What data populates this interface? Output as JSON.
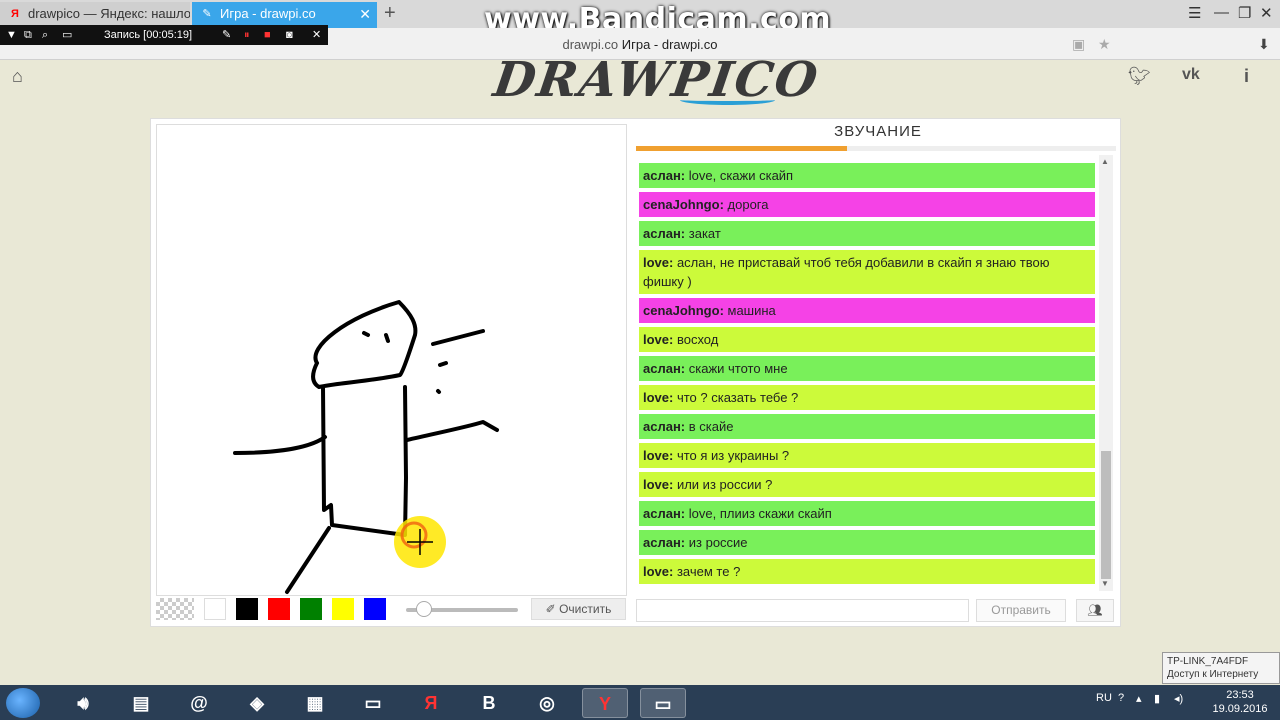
{
  "browser": {
    "tabs": [
      {
        "title": "drawpico — Яндекс: нашло",
        "active": false
      },
      {
        "title": "Игра - drawpi.co",
        "active": true
      }
    ],
    "address": {
      "domain": "drawpi.co",
      "page_title": "Игра - drawpi.co"
    }
  },
  "watermark": "www.Bandicam.com",
  "recorder": {
    "label": "Запись [00:05:19]"
  },
  "logo": "DRAWPICO",
  "game": {
    "word_title": "ЗВУЧАНИЕ",
    "timer_progress": 0.44,
    "tools": {
      "colors": [
        "#ffffff",
        "#000000",
        "#ff0000",
        "#008000",
        "#ffff00",
        "#0000ff"
      ],
      "brush_size": 0.1,
      "clear_label": "Очистить"
    },
    "chat": {
      "messages": [
        {
          "user": "аслан:",
          "text": " love,  скажи скайп",
          "color": "green"
        },
        {
          "user": "cenaJohngo:",
          "text": " дорога",
          "color": "pink"
        },
        {
          "user": "аслан:",
          "text": " закат",
          "color": "green"
        },
        {
          "user": "love:",
          "text": "  аслан,  не приставай чтоб тебя добавили в скайп я знаю твою фишку )",
          "color": "yellow"
        },
        {
          "user": "cenaJohngo:",
          "text": " машина",
          "color": "pink"
        },
        {
          "user": "love:",
          "text": " восход",
          "color": "yellow"
        },
        {
          "user": "аслан:",
          "text": " скажи чтото мне",
          "color": "green"
        },
        {
          "user": "love:",
          "text": " что ? сказать тебе ?",
          "color": "yellow"
        },
        {
          "user": "аслан:",
          "text": " в скайе",
          "color": "green"
        },
        {
          "user": "love:",
          "text": " что я из украины ?",
          "color": "yellow"
        },
        {
          "user": "love:",
          "text": " или из россии ?",
          "color": "yellow"
        },
        {
          "user": "аслан:",
          "text": "  love, плииз скажи скайп",
          "color": "green"
        },
        {
          "user": "аслан:",
          "text": " из россие",
          "color": "green"
        },
        {
          "user": "love:",
          "text": " зачем те ?",
          "color": "yellow"
        }
      ],
      "input_placeholder": "",
      "send_label": "Отправить"
    }
  },
  "taskbar": {
    "language": "RU",
    "time": "23:53",
    "date": "19.09.2016",
    "wifi_tooltip": {
      "name": "TP-LINK_7A4FDF",
      "status": "Доступ к Интернету"
    }
  }
}
